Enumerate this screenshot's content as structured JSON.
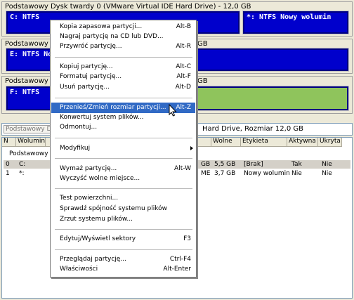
{
  "disks": [
    {
      "title": "Podstawowy Dysk twardy 0 (VMware Virtual IDE Hard Drive) - 12,0 GB",
      "partitions": [
        {
          "label": "C: NTFS"
        },
        {
          "label": "*: NTFS Nowy wolumin"
        }
      ]
    },
    {
      "title_fragment_left": "Podstawowy Dy",
      "title_fragment_right": "GB",
      "partitions": [
        {
          "label": "E: NTFS Nov"
        }
      ]
    },
    {
      "title_fragment_left": "Podstawowy Dys",
      "title_fragment_right": "GB",
      "partitions": [
        {
          "label": "F: NTFS"
        }
      ]
    }
  ],
  "address_bar": {
    "left_text": "Podstawowy Dys",
    "right_text": "Hard Drive, Rozmiar 12,0 GB"
  },
  "list": {
    "columns": [
      "N",
      "Wolumin",
      "",
      "",
      "Wolne",
      "Etykieta",
      "Aktywna",
      "Ukryta"
    ],
    "group_label": "Podstawowy D",
    "rows": [
      {
        "n": "0",
        "volume": "C:",
        "size_frag": "GB",
        "free": "5,5 GB",
        "label": "[Brak]",
        "active": "Tak",
        "hidden": "Nie"
      },
      {
        "n": "1",
        "volume": "*:",
        "size_frag": "ME",
        "free": "3,7 GB",
        "label": "Nowy wolumin",
        "active": "Nie",
        "hidden": "Nie"
      }
    ]
  },
  "context_menu": {
    "items": [
      {
        "label": "Kopia zapasowa partycji...",
        "shortcut": "Alt-B"
      },
      {
        "label": "Nagraj partycję na CD lub DVD...",
        "shortcut": ""
      },
      {
        "label": "Przywróć partycję...",
        "shortcut": "Alt-R"
      },
      {
        "label": "Kopiuj partycję...",
        "shortcut": "Alt-C"
      },
      {
        "label": "Formatuj partycję...",
        "shortcut": "Alt-F"
      },
      {
        "label": "Usuń partycję...",
        "shortcut": "Alt-D"
      },
      {
        "label": "Przenieś/Zmień rozmiar partycji...",
        "shortcut": "Alt-Z"
      },
      {
        "label": "Konwertuj system plików...",
        "shortcut": ""
      },
      {
        "label": "Odmontuj...",
        "shortcut": ""
      },
      {
        "label": "Modyfikuj",
        "shortcut": ""
      },
      {
        "label": "Wymaż partycję...",
        "shortcut": "Alt-W"
      },
      {
        "label": "Wyczyść wolne miejsce...",
        "shortcut": ""
      },
      {
        "label": "Test powierzchni...",
        "shortcut": ""
      },
      {
        "label": "Sprawdź spójność systemu plików",
        "shortcut": ""
      },
      {
        "label": "Zrzut systemu plików...",
        "shortcut": ""
      },
      {
        "label": "Edytuj/Wyświetl sektory",
        "shortcut": "F3"
      },
      {
        "label": "Przeglądaj partycję...",
        "shortcut": "Ctrl-F4"
      },
      {
        "label": "Właściwości",
        "shortcut": "Alt-Enter"
      }
    ],
    "highlighted_index": 6
  },
  "colors": {
    "partition_blue": "#0000cc",
    "free_green": "#8fc45c",
    "highlight": "#316ac5"
  }
}
